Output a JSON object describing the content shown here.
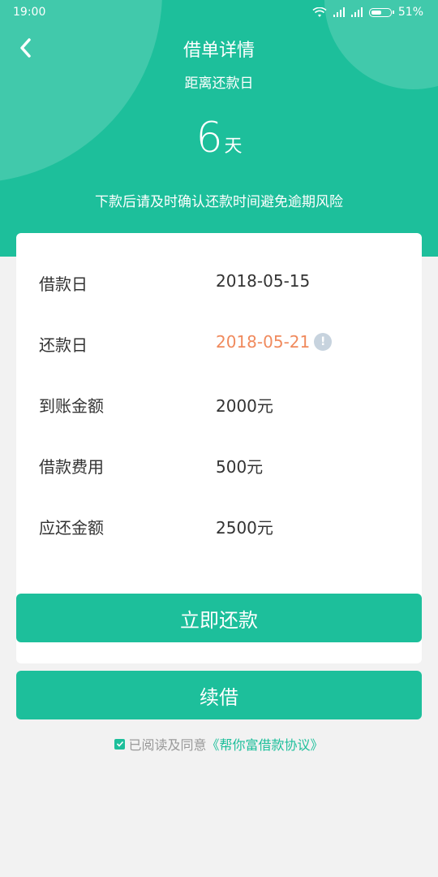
{
  "status_bar": {
    "time": "19:00",
    "battery": "51%"
  },
  "header": {
    "title": "借单详情",
    "subtitle": "距离还款日",
    "days_num": "6",
    "days_unit": "天",
    "notice": "下款后请及时确认还款时间避免逾期风险"
  },
  "details": [
    {
      "label": "借款日",
      "value": "2018-05-15"
    },
    {
      "label": "还款日",
      "value": "2018-05-21"
    },
    {
      "label": "到账金额",
      "value": "2000元"
    },
    {
      "label": "借款费用",
      "value": "500元"
    },
    {
      "label": "应还金额",
      "value": "2500元"
    }
  ],
  "buttons": {
    "repay": "立即还款",
    "renew": "续借"
  },
  "agreement": {
    "text": "已阅读及同意",
    "link": "《帮你富借款协议》"
  },
  "colors": {
    "primary": "#1dbf9b",
    "warn": "#f08a5d",
    "background": "#f2f2f2"
  },
  "icons": {
    "back": "chevron-left-icon",
    "info": "exclamation-icon",
    "check": "check-icon"
  }
}
